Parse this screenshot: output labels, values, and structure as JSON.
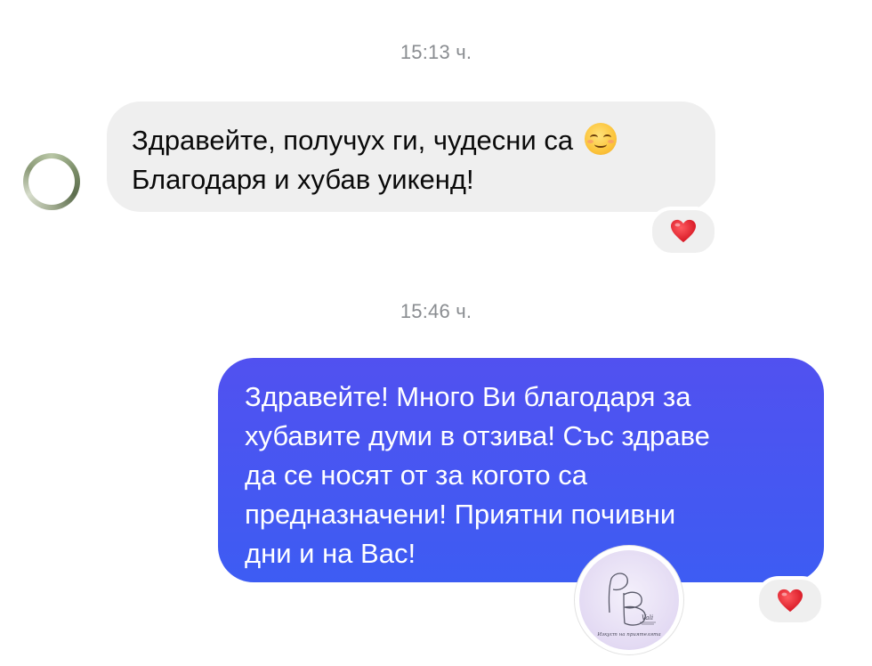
{
  "conversation": {
    "timestamps": [
      "15:13 ч.",
      "15:46 ч."
    ],
    "incoming_message": {
      "lines": [
        "Здравейте, получух ги, чудесни са",
        "Благодаря и хубав уикенд!"
      ],
      "emoji": "smiling-face-with-smiling-eyes",
      "reaction": "heart"
    },
    "outgoing_message": {
      "lines": [
        "Здравейте! Много Ви благодаря за",
        "хубавите думи в отзива! Със здраве",
        "да се носят от за когото са",
        "предназначени! Приятни почивни",
        "дни и на Вас!"
      ],
      "reaction": "heart"
    },
    "logo": {
      "initials": "РВ",
      "brand": "Vali",
      "tagline": "Изкуст на приятелята"
    }
  },
  "colors": {
    "outgoing_bubble": "#4757f1",
    "incoming_bubble": "#efefef",
    "heart": "#e8202f",
    "timestamp": "#8a8d91"
  }
}
